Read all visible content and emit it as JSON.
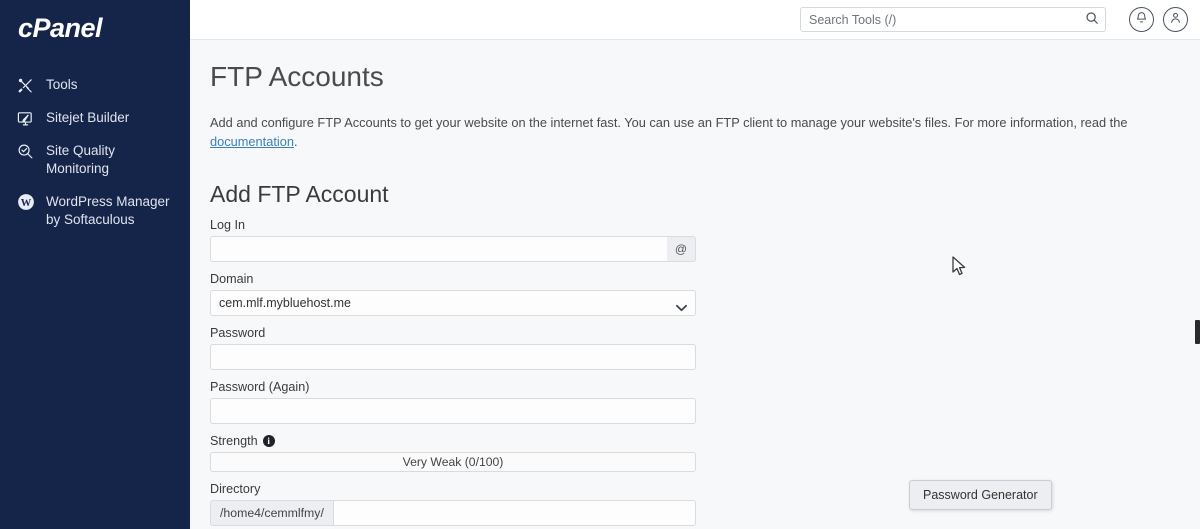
{
  "sidebar": {
    "logo": "cPanel",
    "items": [
      {
        "label": "Tools",
        "icon": "tools-icon"
      },
      {
        "label": "Sitejet Builder",
        "icon": "monitor-pen-icon"
      },
      {
        "label": "Site Quality Monitoring",
        "icon": "magnifier-check-icon"
      },
      {
        "label": "WordPress Manager by Softaculous",
        "icon": "wordpress-icon"
      }
    ],
    "background_color": "#152449"
  },
  "topbar": {
    "search": {
      "placeholder": "Search Tools (/)",
      "value": ""
    },
    "notifications_label": "Notifications",
    "account_label": "Account"
  },
  "page": {
    "title": "FTP Accounts",
    "description_before": "Add and configure FTP Accounts to get your website on the internet fast. You can use an FTP client to manage your website's files. For more information, read the ",
    "description_link": "documentation",
    "description_after": "."
  },
  "form": {
    "heading": "Add FTP Account",
    "login": {
      "label": "Log In",
      "value": "",
      "addon": "@"
    },
    "domain": {
      "label": "Domain",
      "selected": "cem.mlf.mybluehost.me",
      "options": [
        "cem.mlf.mybluehost.me"
      ]
    },
    "password": {
      "label": "Password",
      "value": ""
    },
    "password_again": {
      "label": "Password (Again)",
      "value": ""
    },
    "strength": {
      "label": "Strength",
      "meter_text": "Very Weak (0/100)",
      "score": 0,
      "max": 100
    },
    "password_generator_button": "Password Generator",
    "directory": {
      "label": "Directory",
      "prefix": "/home4/cemmlfmy/",
      "value": ""
    }
  },
  "colors": {
    "sidebar": "#152449",
    "content_bg": "#f7f8fa",
    "link": "#3b7fb8",
    "border": "#d8dbe0"
  }
}
